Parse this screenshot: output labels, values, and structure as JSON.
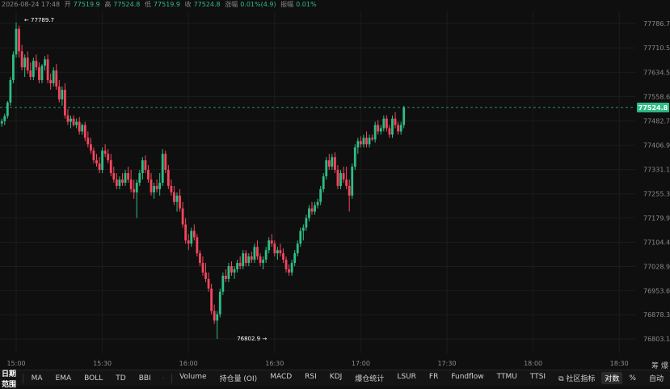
{
  "header": {
    "datetime": "2026-08-24 17:48",
    "open_label": "开",
    "open": "77519.9",
    "high_label": "高",
    "high": "77524.8",
    "low_label": "低",
    "low": "77519.9",
    "close_label": "收",
    "close": "77524.8",
    "change_label": "涨幅",
    "change": "0.01%(4.9)",
    "amplitude_label": "振幅",
    "amplitude": "0.01%"
  },
  "colors": {
    "up": "#2ebd85",
    "down": "#f6465d",
    "bg": "#0f0f0f",
    "grid": "#1c1c1c",
    "axis_text": "#8a8a8a"
  },
  "chart_data": {
    "type": "candlestick",
    "x_ticks": [
      "15:00",
      "15:30",
      "16:00",
      "16:30",
      "17:00",
      "17:30",
      "18:00",
      "18:30"
    ],
    "y_ticks": [
      "77786.7",
      "77710.5",
      "77634.5",
      "77558.6",
      "77482.7",
      "77406.9",
      "77331.1",
      "77255.3",
      "77179.9",
      "77104.4",
      "77028.9",
      "76953.6",
      "76878.3",
      "76803.1"
    ],
    "ylim": [
      76803.1,
      77786.7
    ],
    "x_start": "14:46",
    "x_end": "18:40",
    "interval_minutes": 1,
    "last_price": "77524.8",
    "high_marker": {
      "label": "77789.7",
      "time": "15:09"
    },
    "low_marker": {
      "label": "76802.9",
      "time": "16:29"
    },
    "ohlc": [
      [
        "14:46",
        77440,
        77456,
        77425,
        77450
      ],
      [
        "14:47",
        77450,
        77462,
        77430,
        77438
      ],
      [
        "14:48",
        77438,
        77470,
        77432,
        77465
      ],
      [
        "14:49",
        77465,
        77480,
        77440,
        77445
      ],
      [
        "14:50",
        77445,
        77475,
        77438,
        77470
      ],
      [
        "14:51",
        77470,
        77495,
        77460,
        77485
      ],
      [
        "14:52",
        77485,
        77492,
        77450,
        77455
      ],
      [
        "14:53",
        77455,
        77470,
        77440,
        77465
      ],
      [
        "14:54",
        77465,
        77482,
        77455,
        77475
      ],
      [
        "14:55",
        77475,
        77490,
        77465,
        77482
      ],
      [
        "14:56",
        77482,
        77505,
        77470,
        77498
      ],
      [
        "14:57",
        77498,
        77545,
        77490,
        77540
      ],
      [
        "14:58",
        77540,
        77620,
        77530,
        77610
      ],
      [
        "14:59",
        77610,
        77700,
        77600,
        77690
      ],
      [
        "15:00",
        77690,
        77789.7,
        77680,
        77770
      ],
      [
        "15:01",
        77770,
        77780,
        77680,
        77700
      ],
      [
        "15:02",
        77700,
        77720,
        77640,
        77650
      ],
      [
        "15:03",
        77650,
        77690,
        77620,
        77680
      ],
      [
        "15:04",
        77680,
        77700,
        77630,
        77640
      ],
      [
        "15:05",
        77640,
        77665,
        77610,
        77620
      ],
      [
        "15:06",
        77620,
        77680,
        77610,
        77670
      ],
      [
        "15:07",
        77670,
        77690,
        77640,
        77650
      ],
      [
        "15:08",
        77650,
        77665,
        77600,
        77610
      ],
      [
        "15:09",
        77610,
        77660,
        77600,
        77655
      ],
      [
        "15:10",
        77655,
        77685,
        77640,
        77675
      ],
      [
        "15:11",
        77675,
        77690,
        77600,
        77610
      ],
      [
        "15:12",
        77610,
        77630,
        77580,
        77600
      ],
      [
        "15:13",
        77600,
        77650,
        77590,
        77640
      ],
      [
        "15:14",
        77640,
        77660,
        77580,
        77590
      ],
      [
        "15:15",
        77590,
        77610,
        77540,
        77550
      ],
      [
        "15:16",
        77550,
        77590,
        77530,
        77580
      ],
      [
        "15:17",
        77580,
        77600,
        77490,
        77500
      ],
      [
        "15:18",
        77500,
        77520,
        77470,
        77480
      ],
      [
        "15:19",
        77480,
        77500,
        77460,
        77490
      ],
      [
        "15:20",
        77490,
        77500,
        77465,
        77470
      ],
      [
        "15:21",
        77470,
        77490,
        77460,
        77480
      ],
      [
        "15:22",
        77480,
        77495,
        77440,
        77450
      ],
      [
        "15:23",
        77450,
        77475,
        77440,
        77470
      ],
      [
        "15:24",
        77470,
        77480,
        77420,
        77430
      ],
      [
        "15:25",
        77430,
        77450,
        77400,
        77410
      ],
      [
        "15:26",
        77410,
        77430,
        77380,
        77390
      ],
      [
        "15:27",
        77390,
        77400,
        77350,
        77360
      ],
      [
        "15:28",
        77360,
        77380,
        77340,
        77350
      ],
      [
        "15:29",
        77350,
        77370,
        77320,
        77330
      ],
      [
        "15:30",
        77330,
        77400,
        77320,
        77390
      ],
      [
        "15:31",
        77390,
        77410,
        77370,
        77380
      ],
      [
        "15:32",
        77380,
        77395,
        77350,
        77360
      ],
      [
        "15:33",
        77360,
        77380,
        77310,
        77320
      ],
      [
        "15:34",
        77320,
        77340,
        77290,
        77300
      ],
      [
        "15:35",
        77300,
        77320,
        77270,
        77280
      ],
      [
        "15:36",
        77280,
        77310,
        77270,
        77300
      ],
      [
        "15:37",
        77300,
        77320,
        77280,
        77290
      ],
      [
        "15:38",
        77290,
        77330,
        77280,
        77320
      ],
      [
        "15:39",
        77320,
        77340,
        77290,
        77300
      ],
      [
        "15:40",
        77300,
        77330,
        77260,
        77270
      ],
      [
        "15:41",
        77270,
        77300,
        77240,
        77260
      ],
      [
        "15:42",
        77260,
        77300,
        77180,
        77290
      ],
      [
        "15:43",
        77290,
        77330,
        77280,
        77320
      ],
      [
        "15:44",
        77320,
        77370,
        77300,
        77360
      ],
      [
        "15:45",
        77360,
        77375,
        77320,
        77330
      ],
      [
        "15:46",
        77330,
        77345,
        77290,
        77300
      ],
      [
        "15:47",
        77300,
        77320,
        77250,
        77260
      ],
      [
        "15:48",
        77260,
        77290,
        77240,
        77280
      ],
      [
        "15:49",
        77280,
        77300,
        77260,
        77270
      ],
      [
        "15:50",
        77270,
        77320,
        77250,
        77290
      ],
      [
        "15:51",
        77290,
        77395,
        77280,
        77380
      ],
      [
        "15:52",
        77380,
        77390,
        77320,
        77330
      ],
      [
        "15:53",
        77330,
        77345,
        77270,
        77280
      ],
      [
        "15:54",
        77280,
        77300,
        77250,
        77260
      ],
      [
        "15:55",
        77260,
        77280,
        77220,
        77230
      ],
      [
        "15:56",
        77230,
        77260,
        77200,
        77250
      ],
      [
        "15:57",
        77250,
        77270,
        77200,
        77210
      ],
      [
        "15:58",
        77210,
        77230,
        77150,
        77160
      ],
      [
        "15:59",
        77160,
        77180,
        77100,
        77110
      ],
      [
        "16:00",
        77110,
        77130,
        77080,
        77100
      ],
      [
        "16:01",
        77100,
        77150,
        77090,
        77140
      ],
      [
        "16:02",
        77140,
        77160,
        77110,
        77120
      ],
      [
        "16:03",
        77120,
        77130,
        77060,
        77070
      ],
      [
        "16:04",
        77070,
        77080,
        77030,
        77040
      ],
      [
        "16:05",
        77040,
        77060,
        77000,
        77010
      ],
      [
        "16:06",
        77010,
        77040,
        76980,
        76990
      ],
      [
        "16:07",
        76990,
        77010,
        76950,
        76960
      ],
      [
        "16:08",
        76960,
        76975,
        76880,
        76890
      ],
      [
        "16:09",
        76890,
        76910,
        76850,
        76860
      ],
      [
        "16:10",
        76860,
        76890,
        76802.9,
        76880
      ],
      [
        "16:11",
        76880,
        76960,
        76870,
        76950
      ],
      [
        "16:12",
        76950,
        77010,
        76940,
        77000
      ],
      [
        "16:13",
        77000,
        77020,
        76980,
        76990
      ],
      [
        "16:14",
        76990,
        77040,
        76980,
        77030
      ],
      [
        "16:15",
        77030,
        77045,
        77000,
        77010
      ],
      [
        "16:16",
        77010,
        77030,
        76990,
        77020
      ],
      [
        "16:17",
        77020,
        77050,
        77010,
        77040
      ],
      [
        "16:18",
        77040,
        77060,
        77020,
        77030
      ],
      [
        "16:19",
        77030,
        77080,
        77020,
        77070
      ],
      [
        "16:20",
        77070,
        77080,
        77030,
        77040
      ],
      [
        "16:21",
        77040,
        77070,
        77030,
        77060
      ],
      [
        "16:22",
        77060,
        77075,
        77040,
        77050
      ],
      [
        "16:23",
        77050,
        77100,
        77040,
        77090
      ],
      [
        "16:24",
        77090,
        77110,
        77050,
        77060
      ],
      [
        "16:25",
        77060,
        77070,
        77030,
        77040
      ],
      [
        "16:26",
        77040,
        77060,
        77020,
        77050
      ],
      [
        "16:27",
        77050,
        77090,
        77040,
        77080
      ],
      [
        "16:28",
        77080,
        77120,
        77070,
        77110
      ],
      [
        "16:29",
        77110,
        77130,
        77090,
        77100
      ],
      [
        "16:30",
        77100,
        77110,
        77060,
        77070
      ],
      [
        "16:31",
        77070,
        77090,
        77050,
        77080
      ],
      [
        "16:32",
        77080,
        77100,
        77060,
        77070
      ],
      [
        "16:33",
        77070,
        77085,
        77040,
        77050
      ],
      [
        "16:34",
        77050,
        77060,
        77010,
        77020
      ],
      [
        "16:35",
        77020,
        77035,
        77000,
        77010
      ],
      [
        "16:36",
        77010,
        77050,
        77000,
        77040
      ],
      [
        "16:37",
        77040,
        77080,
        77030,
        77070
      ],
      [
        "16:38",
        77070,
        77110,
        77060,
        77100
      ],
      [
        "16:39",
        77100,
        77150,
        77090,
        77140
      ],
      [
        "16:40",
        77140,
        77160,
        77110,
        77150
      ],
      [
        "16:41",
        77150,
        77190,
        77140,
        77180
      ],
      [
        "16:42",
        77180,
        77220,
        77170,
        77210
      ],
      [
        "16:43",
        77210,
        77230,
        77190,
        77200
      ],
      [
        "16:44",
        77200,
        77230,
        77190,
        77220
      ],
      [
        "16:45",
        77220,
        77240,
        77210,
        77230
      ],
      [
        "16:46",
        77230,
        77280,
        77220,
        77270
      ],
      [
        "16:47",
        77270,
        77320,
        77260,
        77310
      ],
      [
        "16:48",
        77310,
        77370,
        77300,
        77360
      ],
      [
        "16:49",
        77360,
        77380,
        77330,
        77340
      ],
      [
        "16:50",
        77340,
        77380,
        77330,
        77370
      ],
      [
        "16:51",
        77370,
        77385,
        77320,
        77330
      ],
      [
        "16:52",
        77330,
        77345,
        77270,
        77280
      ],
      [
        "16:53",
        77280,
        77330,
        77270,
        77320
      ],
      [
        "16:54",
        77320,
        77340,
        77290,
        77300
      ],
      [
        "16:55",
        77300,
        77340,
        77270,
        77280
      ],
      [
        "16:56",
        77280,
        77300,
        77200,
        77250
      ],
      [
        "16:57",
        77250,
        77350,
        77240,
        77340
      ],
      [
        "16:58",
        77340,
        77410,
        77330,
        77400
      ],
      [
        "16:59",
        77400,
        77430,
        77380,
        77420
      ],
      [
        "17:00",
        77420,
        77435,
        77400,
        77410
      ],
      [
        "17:01",
        77410,
        77440,
        77400,
        77430
      ],
      [
        "17:02",
        77430,
        77450,
        77400,
        77410
      ],
      [
        "17:03",
        77410,
        77440,
        77400,
        77430
      ],
      [
        "17:04",
        77430,
        77440,
        77420,
        77425
      ],
      [
        "17:05",
        77425,
        77480,
        77415,
        77470
      ],
      [
        "17:06",
        77470,
        77485,
        77440,
        77450
      ],
      [
        "17:07",
        77450,
        77470,
        77440,
        77460
      ],
      [
        "17:08",
        77460,
        77500,
        77450,
        77490
      ],
      [
        "17:09",
        77490,
        77500,
        77450,
        77460
      ],
      [
        "17:10",
        77460,
        77470,
        77430,
        77440
      ],
      [
        "17:11",
        77440,
        77500,
        77430,
        77490
      ],
      [
        "17:12",
        77490,
        77510,
        77460,
        77470
      ],
      [
        "17:13",
        77470,
        77480,
        77440,
        77450
      ],
      [
        "17:14",
        77450,
        77480,
        77440,
        77470
      ],
      [
        "17:15",
        77470,
        77530,
        77460,
        77524.8
      ]
    ]
  },
  "toolbar": {
    "date_range": "日期范围",
    "indicators": [
      "MA",
      "EMA",
      "BOLL",
      "TD",
      "BBI"
    ],
    "sub_indicators": [
      "Volume",
      "持仓量 (OI)",
      "MACD",
      "RSI",
      "KDJ",
      "爆仓统计",
      "LSUR",
      "FR",
      "Fundflow",
      "TTMU",
      "TTSI"
    ],
    "community": "社区指标",
    "log": "对数",
    "percent": "%",
    "auto": "自动"
  },
  "corner": {
    "draw": "筹",
    "explode": "爆"
  }
}
